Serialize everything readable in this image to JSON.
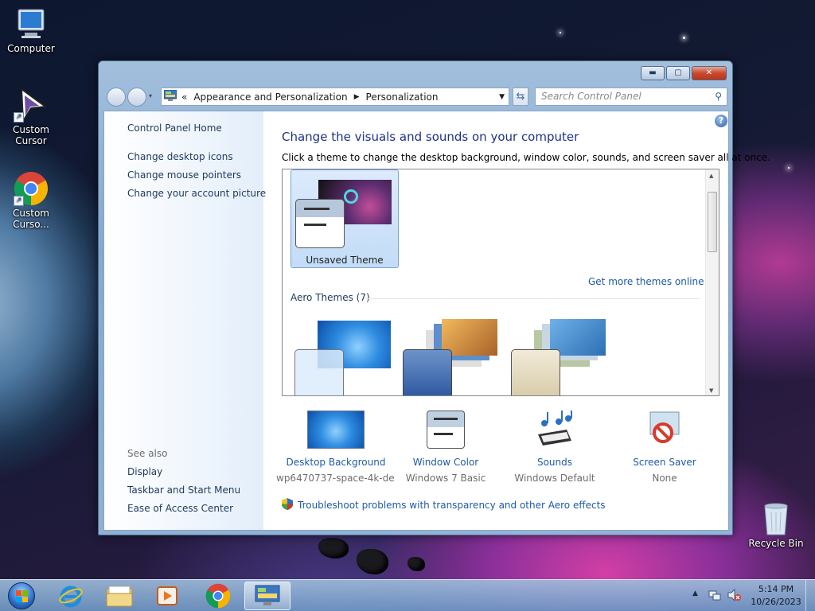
{
  "desktop": {
    "icons": [
      {
        "label": "Computer",
        "icon": "computer-icon"
      },
      {
        "label": "Custom\nCursor",
        "icon": "cursor-shortcut-icon"
      },
      {
        "label": "Custom\nCurso...",
        "icon": "chrome-shortcut-icon"
      },
      {
        "label": "Recycle Bin",
        "icon": "recycle-bin-icon"
      }
    ]
  },
  "window": {
    "caption_buttons": {
      "minimize": "▬",
      "maximize": "▢",
      "close": "✕"
    },
    "address": {
      "chevron": "«",
      "crumbs": [
        "Appearance and Personalization",
        "Personalization"
      ]
    },
    "search_placeholder": "Search Control Panel",
    "left_nav": {
      "home": "Control Panel Home",
      "links": [
        "Change desktop icons",
        "Change mouse pointers",
        "Change your account picture"
      ],
      "see_also_title": "See also",
      "see_also": [
        "Display",
        "Taskbar and Start Menu",
        "Ease of Access Center"
      ]
    },
    "heading": "Change the visuals and sounds on your computer",
    "subtext": "Click a theme to change the desktop background, window color, sounds, and screen saver all at once.",
    "selected_theme": "Unsaved Theme",
    "get_more": "Get more themes online",
    "aero_section": "Aero Themes (7)",
    "bottom": [
      {
        "title": "Desktop Background",
        "value": "wp6470737-space-4k-de...",
        "icon": "desktop-background-icon"
      },
      {
        "title": "Window Color",
        "value": "Windows 7 Basic",
        "icon": "window-color-icon"
      },
      {
        "title": "Sounds",
        "value": "Windows Default",
        "icon": "sounds-icon"
      },
      {
        "title": "Screen Saver",
        "value": "None",
        "icon": "screen-saver-icon"
      }
    ],
    "troubleshoot": "Troubleshoot problems with transparency and other Aero effects"
  },
  "taskbar": {
    "items": [
      "start-orb",
      "internet-explorer-icon",
      "file-explorer-icon",
      "media-player-icon",
      "chrome-icon",
      "control-panel-icon"
    ],
    "clock_time": "5:14 PM",
    "clock_date": "10/26/2023"
  },
  "colors": {
    "link": "#1e5aa8",
    "heading": "#1e3287",
    "nav_text": "#1e395b"
  }
}
